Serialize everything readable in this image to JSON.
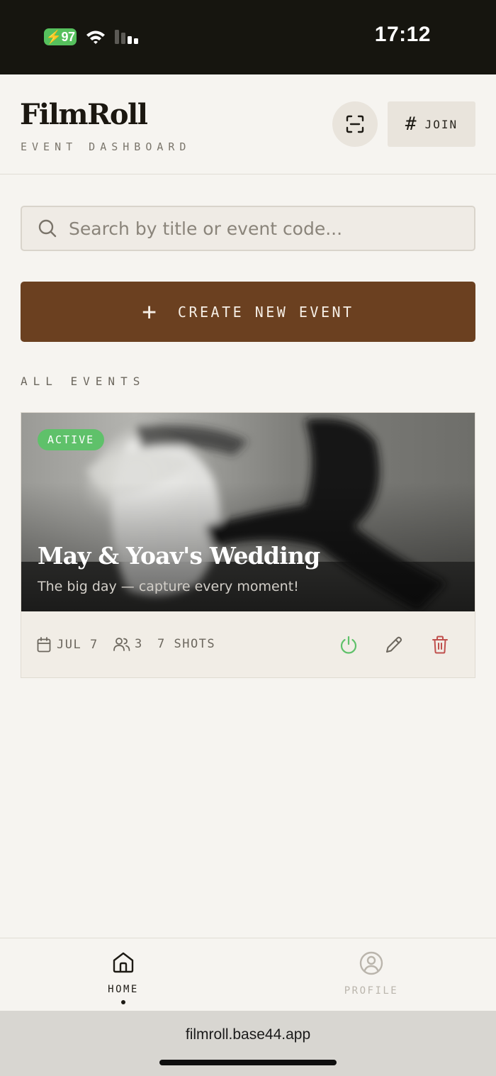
{
  "status_bar": {
    "battery": "97",
    "time": "17:12"
  },
  "header": {
    "brand": "FilmRoll",
    "subtitle": "EVENT DASHBOARD",
    "join_hash": "#",
    "join_label": "JOIN"
  },
  "search": {
    "placeholder": "Search by title or event code..."
  },
  "create_button": {
    "plus": "+",
    "label": "CREATE NEW EVENT"
  },
  "section_label": "ALL EVENTS",
  "events": [
    {
      "status": "ACTIVE",
      "title": "May & Yoav's Wedding",
      "subtitle": "The big day — capture every moment!",
      "date": "JUL 7",
      "guests": "3",
      "shots": "7 SHOTS"
    }
  ],
  "nav": {
    "home": "HOME",
    "profile": "PROFILE"
  },
  "url": "filmroll.base44.app",
  "colors": {
    "accent": "#6b4020",
    "active": "#5fc16a",
    "danger": "#c0504d",
    "background": "#f6f4f0"
  },
  "icons": [
    "battery-icon",
    "wifi-icon",
    "cellular-icon",
    "scan-icon",
    "search-icon",
    "plus-icon",
    "calendar-icon",
    "users-icon",
    "power-icon",
    "pencil-icon",
    "trash-icon",
    "home-icon",
    "profile-icon"
  ]
}
